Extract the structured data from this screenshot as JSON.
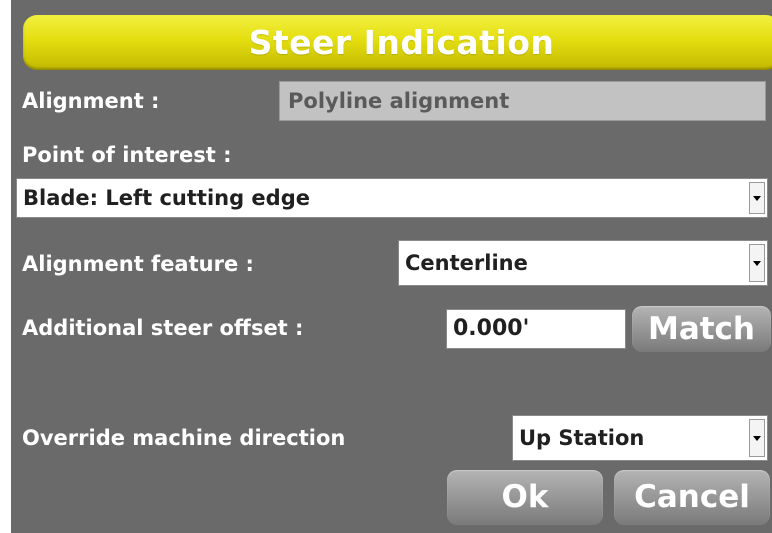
{
  "dialog": {
    "title": "Steer Indication"
  },
  "fields": {
    "alignment_label": "Alignment :",
    "alignment_value": "Polyline alignment",
    "point_of_interest_label": "Point of interest :",
    "point_of_interest_value": "Blade: Left cutting edge",
    "alignment_feature_label": "Alignment feature :",
    "alignment_feature_value": "Centerline",
    "steer_offset_label": "Additional steer offset :",
    "steer_offset_value": "0.000'",
    "override_direction_label": "Override machine direction",
    "override_direction_value": "Up Station"
  },
  "buttons": {
    "match": "Match",
    "ok": "Ok",
    "cancel": "Cancel"
  },
  "icons": {
    "dropdown": "chevron-down-icon"
  },
  "colors": {
    "title_bar": "#e4de10",
    "panel": "#6a6a6a",
    "button": "#949494"
  }
}
